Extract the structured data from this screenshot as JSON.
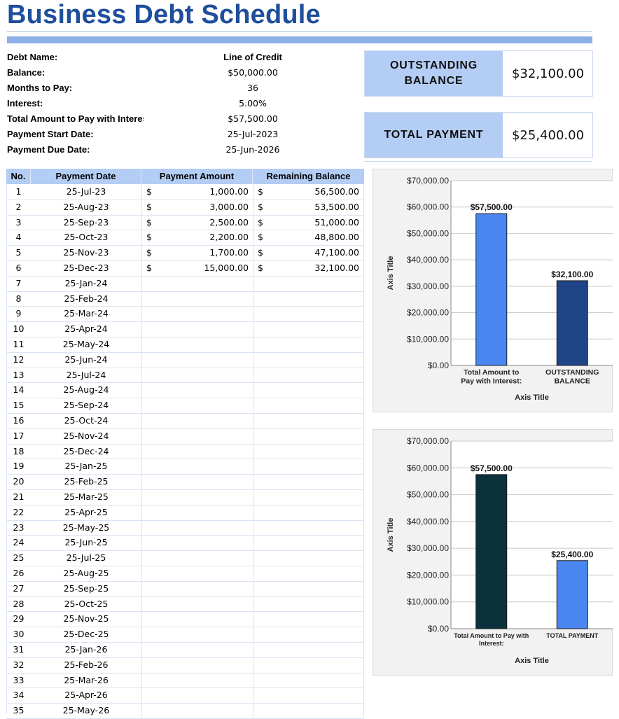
{
  "title": "Business Debt Schedule",
  "info": {
    "rows": [
      {
        "label": "Debt Name:",
        "value": "Line of Credit"
      },
      {
        "label": "Balance:",
        "value": "$50,000.00"
      },
      {
        "label": "Months to Pay:",
        "value": "36"
      },
      {
        "label": "Interest:",
        "value": "5.00%"
      },
      {
        "label": "Total Amount to Pay with Interest:",
        "value": "$57,500.00"
      },
      {
        "label": "Payment Start Date:",
        "value": "25-Jul-2023"
      },
      {
        "label": "Payment Due Date:",
        "value": "25-Jun-2026"
      }
    ]
  },
  "summary": {
    "outstanding": {
      "label": "OUTSTANDING BALANCE",
      "value": "$32,100.00"
    },
    "total_payment": {
      "label": "TOTAL PAYMENT",
      "value": "$25,400.00"
    }
  },
  "table": {
    "headers": [
      "No.",
      "Payment Date",
      "Payment Amount",
      "Remaining Balance"
    ],
    "currency_symbol": "$",
    "rows": [
      {
        "no": "1",
        "date": "25-Jul-23",
        "amount": "1,000.00",
        "balance": "56,500.00"
      },
      {
        "no": "2",
        "date": "25-Aug-23",
        "amount": "3,000.00",
        "balance": "53,500.00"
      },
      {
        "no": "3",
        "date": "25-Sep-23",
        "amount": "2,500.00",
        "balance": "51,000.00"
      },
      {
        "no": "4",
        "date": "25-Oct-23",
        "amount": "2,200.00",
        "balance": "48,800.00"
      },
      {
        "no": "5",
        "date": "25-Nov-23",
        "amount": "1,700.00",
        "balance": "47,100.00"
      },
      {
        "no": "6",
        "date": "25-Dec-23",
        "amount": "15,000.00",
        "balance": "32,100.00"
      },
      {
        "no": "7",
        "date": "25-Jan-24",
        "amount": "",
        "balance": ""
      },
      {
        "no": "8",
        "date": "25-Feb-24",
        "amount": "",
        "balance": ""
      },
      {
        "no": "9",
        "date": "25-Mar-24",
        "amount": "",
        "balance": ""
      },
      {
        "no": "10",
        "date": "25-Apr-24",
        "amount": "",
        "balance": ""
      },
      {
        "no": "11",
        "date": "25-May-24",
        "amount": "",
        "balance": ""
      },
      {
        "no": "12",
        "date": "25-Jun-24",
        "amount": "",
        "balance": ""
      },
      {
        "no": "13",
        "date": "25-Jul-24",
        "amount": "",
        "balance": ""
      },
      {
        "no": "14",
        "date": "25-Aug-24",
        "amount": "",
        "balance": ""
      },
      {
        "no": "15",
        "date": "25-Sep-24",
        "amount": "",
        "balance": ""
      },
      {
        "no": "16",
        "date": "25-Oct-24",
        "amount": "",
        "balance": ""
      },
      {
        "no": "17",
        "date": "25-Nov-24",
        "amount": "",
        "balance": ""
      },
      {
        "no": "18",
        "date": "25-Dec-24",
        "amount": "",
        "balance": ""
      },
      {
        "no": "19",
        "date": "25-Jan-25",
        "amount": "",
        "balance": ""
      },
      {
        "no": "20",
        "date": "25-Feb-25",
        "amount": "",
        "balance": ""
      },
      {
        "no": "21",
        "date": "25-Mar-25",
        "amount": "",
        "balance": ""
      },
      {
        "no": "22",
        "date": "25-Apr-25",
        "amount": "",
        "balance": ""
      },
      {
        "no": "23",
        "date": "25-May-25",
        "amount": "",
        "balance": ""
      },
      {
        "no": "24",
        "date": "25-Jun-25",
        "amount": "",
        "balance": ""
      },
      {
        "no": "25",
        "date": "25-Jul-25",
        "amount": "",
        "balance": ""
      },
      {
        "no": "26",
        "date": "25-Aug-25",
        "amount": "",
        "balance": ""
      },
      {
        "no": "27",
        "date": "25-Sep-25",
        "amount": "",
        "balance": ""
      },
      {
        "no": "28",
        "date": "25-Oct-25",
        "amount": "",
        "balance": ""
      },
      {
        "no": "29",
        "date": "25-Nov-25",
        "amount": "",
        "balance": ""
      },
      {
        "no": "30",
        "date": "25-Dec-25",
        "amount": "",
        "balance": ""
      },
      {
        "no": "31",
        "date": "25-Jan-26",
        "amount": "",
        "balance": ""
      },
      {
        "no": "32",
        "date": "25-Feb-26",
        "amount": "",
        "balance": ""
      },
      {
        "no": "33",
        "date": "25-Mar-26",
        "amount": "",
        "balance": ""
      },
      {
        "no": "34",
        "date": "25-Apr-26",
        "amount": "",
        "balance": ""
      },
      {
        "no": "35",
        "date": "25-May-26",
        "amount": "",
        "balance": ""
      }
    ]
  },
  "chart_data": [
    {
      "type": "bar",
      "categories": [
        "Total Amount to Pay with Interest:",
        "OUTSTANDING BALANCE"
      ],
      "category_lines": [
        [
          "Total Amount to",
          "Pay with Interest:"
        ],
        [
          "OUTSTANDING",
          "BALANCE"
        ]
      ],
      "values": [
        57500,
        32100
      ],
      "data_labels": [
        "$57,500.00",
        "$32,100.00"
      ],
      "colors": [
        "#4a86f0",
        "#1f4487"
      ],
      "xlabel": "Axis Title",
      "ylabel": "Axis Title",
      "ylim": [
        0,
        70000
      ],
      "yticks": [
        0,
        10000,
        20000,
        30000,
        40000,
        50000,
        60000,
        70000
      ],
      "ytick_labels": [
        "$0.00",
        "$10,000.00",
        "$20,000.00",
        "$30,000.00",
        "$40,000.00",
        "$50,000.00",
        "$60,000.00",
        "$70,000.00"
      ],
      "grid": true
    },
    {
      "type": "bar",
      "categories": [
        "Total Amount to Pay with Interest:",
        "TOTAL PAYMENT"
      ],
      "category_lines": [
        [
          "Total Amount to Pay with",
          "Interest:"
        ],
        [
          "TOTAL PAYMENT"
        ]
      ],
      "values": [
        57500,
        25400
      ],
      "data_labels": [
        "$57,500.00",
        "$25,400.00"
      ],
      "colors": [
        "#0b313d",
        "#4a86f0"
      ],
      "xlabel": "Axis Title",
      "ylabel": "Axis Title",
      "ylim": [
        0,
        70000
      ],
      "yticks": [
        0,
        10000,
        20000,
        30000,
        40000,
        50000,
        60000,
        70000
      ],
      "ytick_labels": [
        "$0.00",
        "$10,000.00",
        "$20,000.00",
        "$30,000.00",
        "$40,000.00",
        "$50,000.00",
        "$60,000.00",
        "$70,000.00"
      ],
      "grid": true
    }
  ]
}
